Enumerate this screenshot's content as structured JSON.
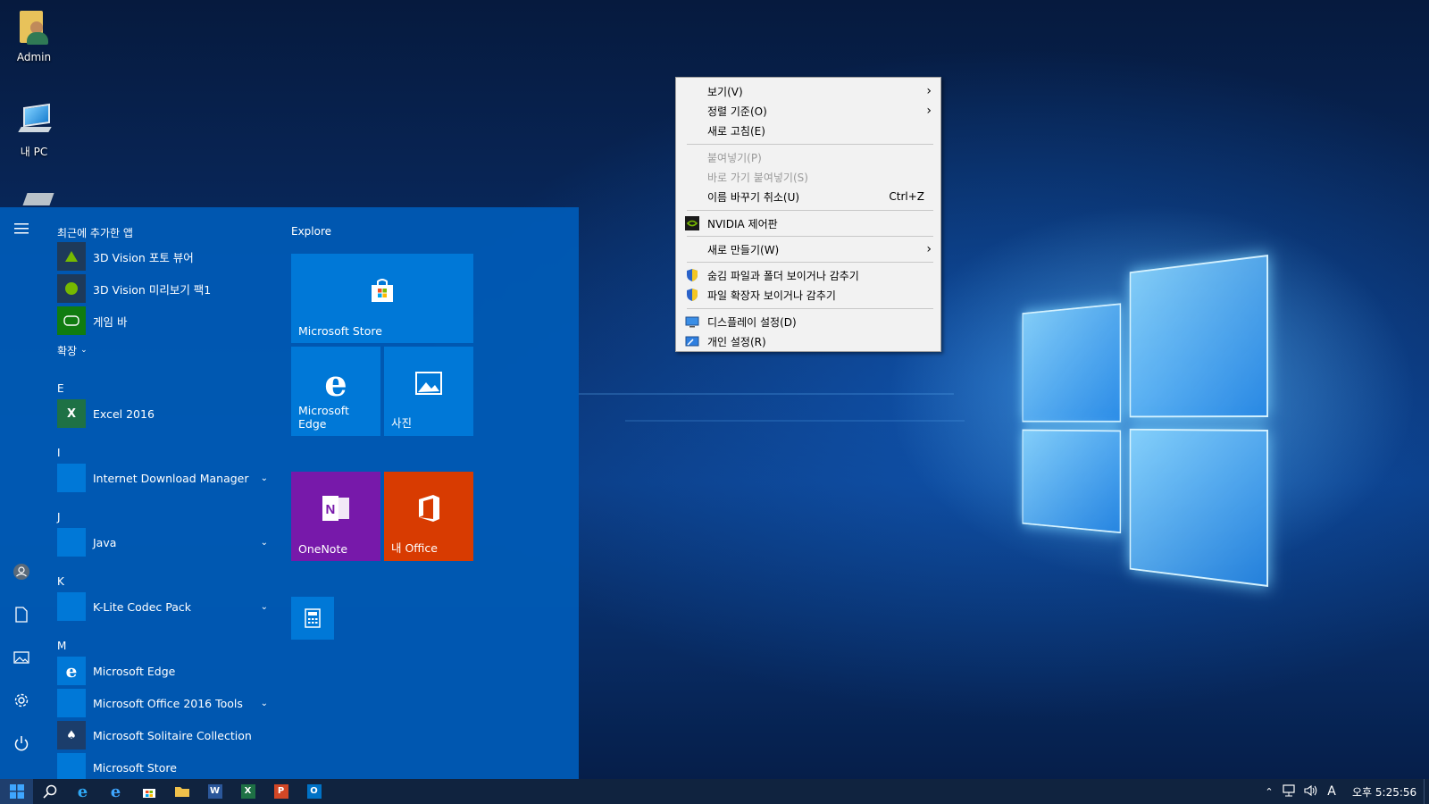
{
  "desktop": {
    "icons": [
      {
        "label": "Admin",
        "icon": "user-folder-icon"
      },
      {
        "label": "내 PC",
        "icon": "computer-icon"
      },
      {
        "label": "",
        "icon": "network-drive-icon"
      }
    ]
  },
  "start_menu": {
    "recent_title": "최근에 추가한 앱",
    "recent_apps": [
      {
        "label": "3D Vision 포토 뷰어",
        "icon": "3d-vision-icon"
      },
      {
        "label": "3D Vision 미리보기 팩1",
        "icon": "3d-vision-preview-icon"
      },
      {
        "label": "게임 바",
        "icon": "game-bar-icon"
      }
    ],
    "expand_label": "확장",
    "letters": {
      "e": "E",
      "i": "I",
      "j": "J",
      "k": "K",
      "m": "M"
    },
    "apps": {
      "excel": "Excel 2016",
      "idm": "Internet Download Manager",
      "java": "Java",
      "klite": "K-Lite Codec Pack",
      "edge": "Microsoft Edge",
      "office_tools": "Microsoft Office 2016 Tools",
      "solitaire": "Microsoft Solitaire Collection",
      "store": "Microsoft Store"
    },
    "explore_title": "Explore",
    "tiles": {
      "store": "Microsoft Store",
      "edge": "Microsoft Edge",
      "photos": "사진",
      "onenote": "OneNote",
      "office": "내 Office"
    },
    "tile_colors": {
      "store": "#0078d7",
      "onenote": "#7719aa",
      "office": "#d83b01"
    }
  },
  "context_menu": {
    "items": [
      {
        "label": "보기(V)",
        "submenu": true,
        "enabled": true
      },
      {
        "label": "정렬 기준(O)",
        "submenu": true,
        "enabled": true
      },
      {
        "label": "새로 고침(E)",
        "submenu": false,
        "enabled": true
      },
      {
        "label": "붙여넣기(P)",
        "submenu": false,
        "enabled": false
      },
      {
        "label": "바로 가기 붙여넣기(S)",
        "submenu": false,
        "enabled": false
      },
      {
        "label": "이름 바꾸기 취소(U)",
        "shortcut": "Ctrl+Z",
        "submenu": false,
        "enabled": true
      },
      {
        "label": "NVIDIA 제어판",
        "icon": "nvidia-icon",
        "enabled": true
      },
      {
        "label": "새로 만들기(W)",
        "submenu": true,
        "enabled": true
      },
      {
        "label": "숨김 파일과 폴더 보이거나 감추기",
        "icon": "uac-shield-icon",
        "enabled": true
      },
      {
        "label": "파일 확장자 보이거나 감추기",
        "icon": "uac-shield-icon",
        "enabled": true
      },
      {
        "label": "디스플레이 설정(D)",
        "icon": "display-icon",
        "enabled": true
      },
      {
        "label": "개인 설정(R)",
        "icon": "personalize-icon",
        "enabled": true
      }
    ]
  },
  "taskbar": {
    "clock": "오후 5:25:56",
    "ime": "A"
  }
}
